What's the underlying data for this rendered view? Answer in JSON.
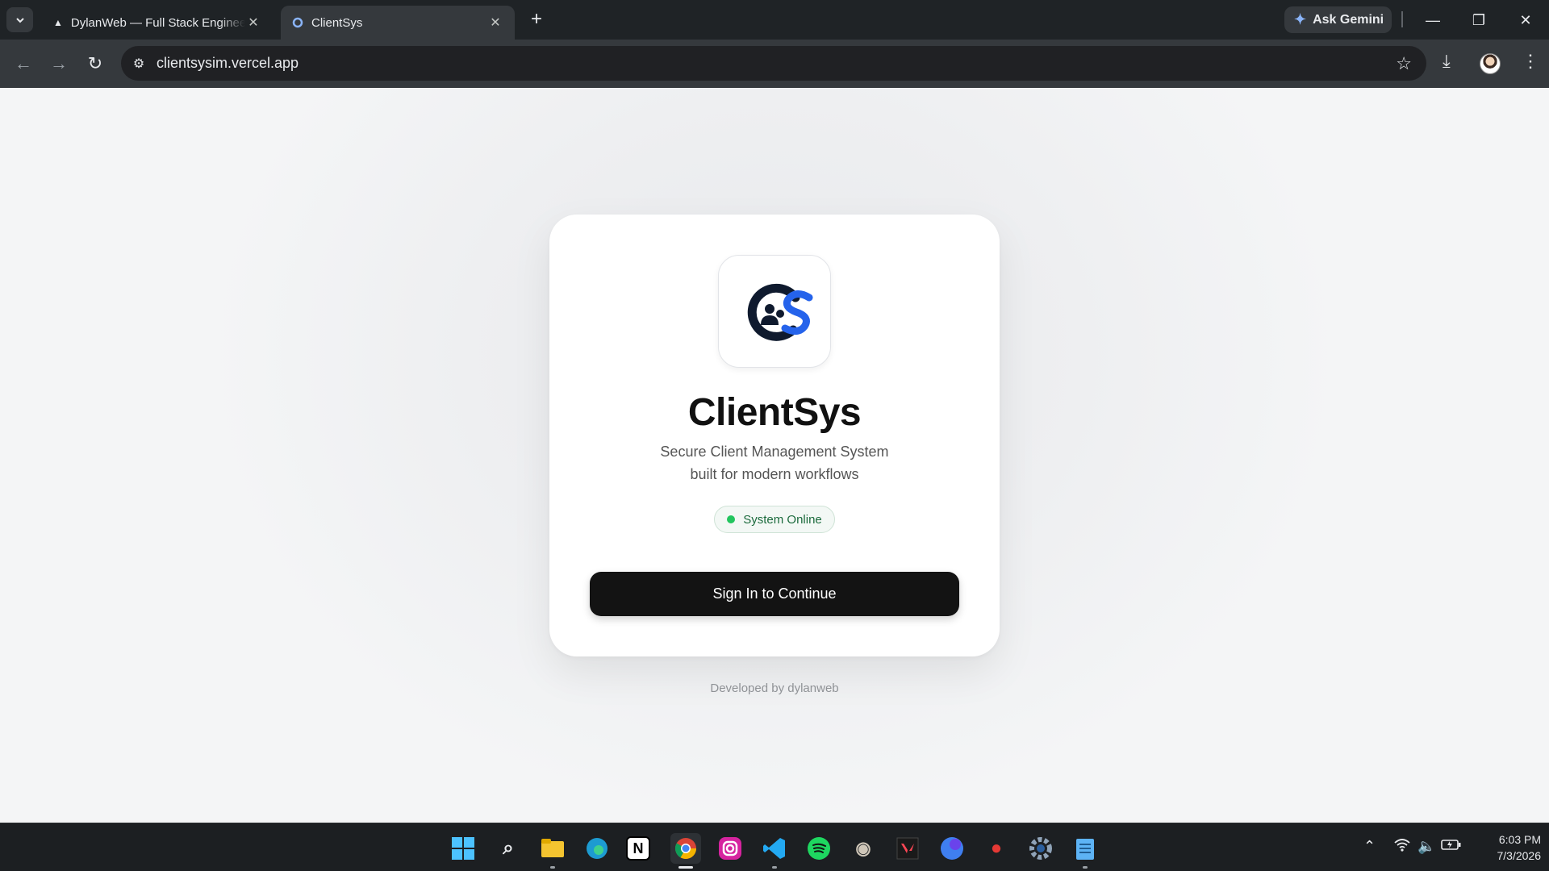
{
  "browser": {
    "tabs": [
      {
        "title": "DylanWeb — Full Stack Engineer",
        "active": false
      },
      {
        "title": "ClientSys",
        "active": true
      }
    ],
    "ask_gemini": "Ask Gemini",
    "url": "clientsysim.vercel.app"
  },
  "page": {
    "brand": "ClientSys",
    "tagline_line1": "Secure Client Management System",
    "tagline_line2": "built for modern workflows",
    "status": "System Online",
    "status_color": "#22c55e",
    "signin_label": "Sign In to Continue",
    "footer": "Developed by dylanweb",
    "logo_colors": {
      "dark": "#0f1a2e",
      "accent": "#2563eb"
    }
  },
  "taskbar": {
    "apps": [
      "windows-start",
      "search",
      "file-explorer",
      "edge",
      "notion",
      "chrome",
      "instagram",
      "vscode",
      "spotify",
      "gimp",
      "valorant",
      "canva",
      "tomato-timer",
      "settings",
      "notepad"
    ],
    "time": "6:03 PM",
    "date": "7/3/2026"
  }
}
